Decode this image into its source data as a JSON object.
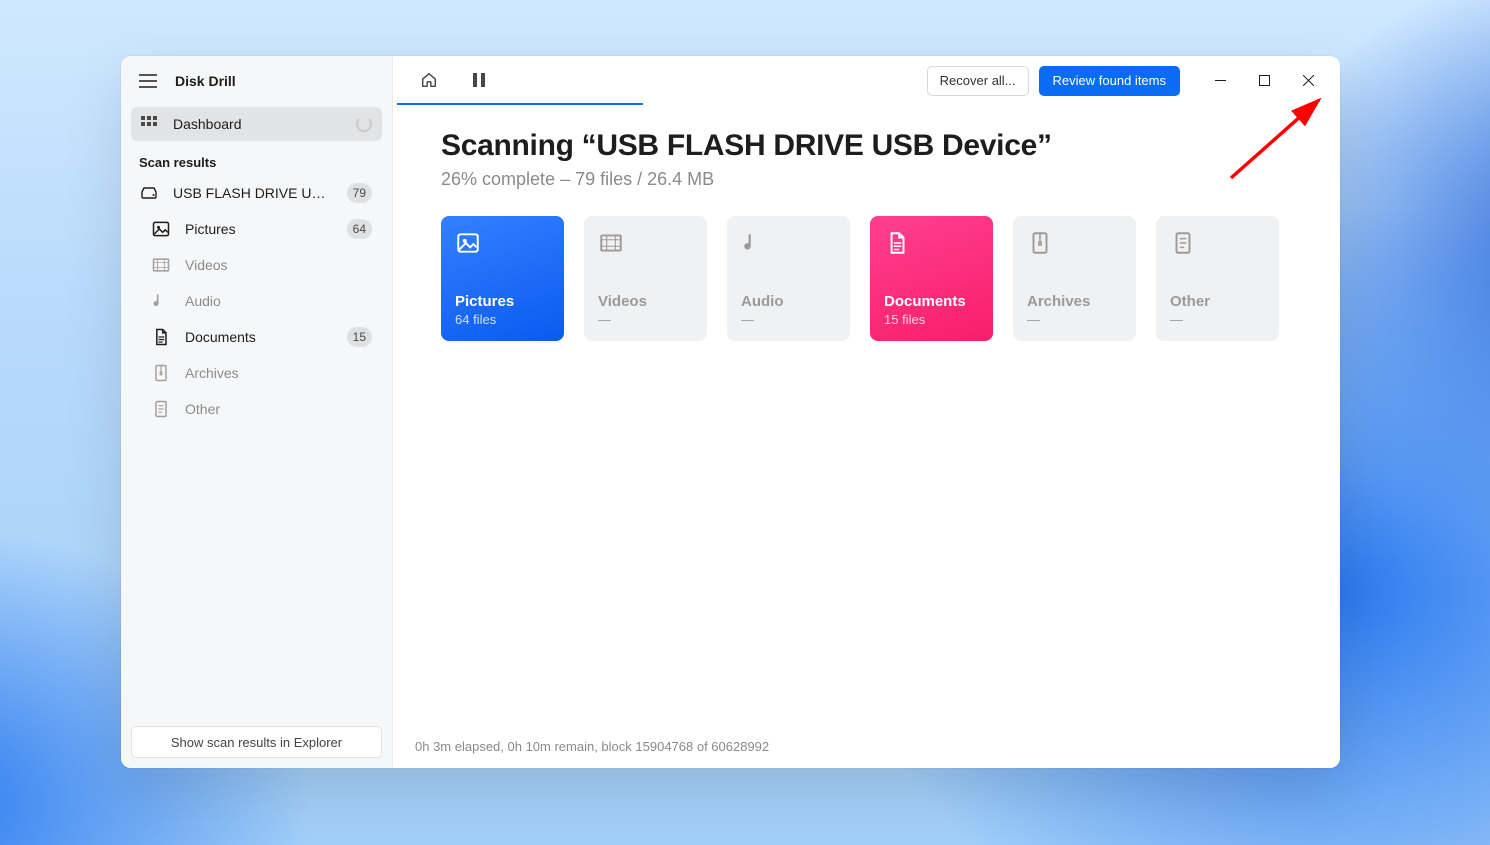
{
  "app": {
    "title": "Disk Drill"
  },
  "sidebar": {
    "dashboard_label": "Dashboard",
    "scan_results_header": "Scan results",
    "drive_name": "USB FLASH DRIVE USB D...",
    "drive_count": "79",
    "items": [
      {
        "label": "Pictures",
        "count": "64",
        "iconkey": "picture",
        "strong": true
      },
      {
        "label": "Videos",
        "count": "",
        "iconkey": "video",
        "strong": false
      },
      {
        "label": "Audio",
        "count": "",
        "iconkey": "audio",
        "strong": false
      },
      {
        "label": "Documents",
        "count": "15",
        "iconkey": "document",
        "strong": true
      },
      {
        "label": "Archives",
        "count": "",
        "iconkey": "archive",
        "strong": false
      },
      {
        "label": "Other",
        "count": "",
        "iconkey": "other",
        "strong": false
      }
    ],
    "explorer_btn": "Show scan results in Explorer"
  },
  "toolbar": {
    "recover_label": "Recover all...",
    "review_label": "Review found items"
  },
  "scan": {
    "title": "Scanning “USB FLASH DRIVE USB Device”",
    "subtitle": "26% complete – 79 files / 26.4 MB"
  },
  "cards": [
    {
      "label": "Pictures",
      "sub": "64 files",
      "variant": "blue",
      "iconkey": "picture"
    },
    {
      "label": "Videos",
      "sub": "—",
      "variant": "",
      "iconkey": "video"
    },
    {
      "label": "Audio",
      "sub": "—",
      "variant": "",
      "iconkey": "audio"
    },
    {
      "label": "Documents",
      "sub": "15 files",
      "variant": "pink",
      "iconkey": "document"
    },
    {
      "label": "Archives",
      "sub": "—",
      "variant": "",
      "iconkey": "archive"
    },
    {
      "label": "Other",
      "sub": "—",
      "variant": "",
      "iconkey": "other"
    }
  ],
  "status": "0h 3m elapsed, 0h 10m remain, block 15904768 of 60628992"
}
